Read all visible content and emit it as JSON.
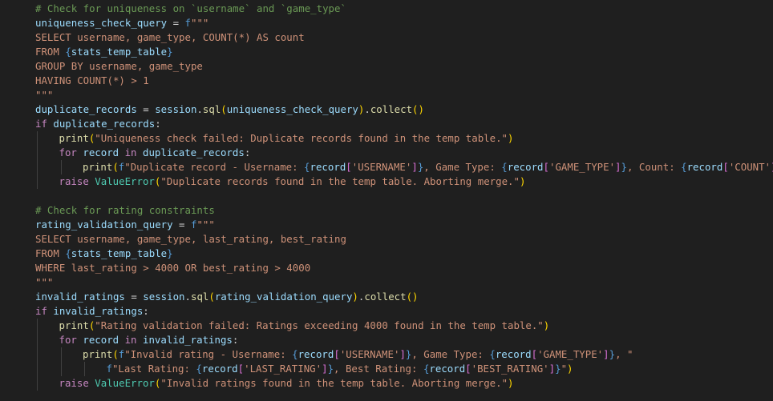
{
  "editor": {
    "language": "python",
    "theme_colors": {
      "background": "#1f1f1f",
      "comment": "#6a9955",
      "variable": "#9cdcfe",
      "string": "#ce9178",
      "keyword": "#c586c0",
      "function": "#dcdcaa",
      "class": "#4ec9b0",
      "brace": "#569cd6",
      "bracket_level_1": "#ffd700",
      "bracket_level_2": "#da70d6",
      "bracket_level_3": "#179fff"
    },
    "lines": [
      {
        "indent": 0,
        "tokens": [
          [
            "comment",
            "# Check for uniqueness on `username` and `game_type`"
          ]
        ]
      },
      {
        "indent": 0,
        "tokens": [
          [
            "var",
            "uniqueness_check_query"
          ],
          [
            "op",
            " = "
          ],
          [
            "brace",
            "f"
          ],
          [
            "str",
            "\"\"\""
          ]
        ]
      },
      {
        "indent": 0,
        "tokens": [
          [
            "str",
            "SELECT username, game_type, COUNT(*) AS count"
          ]
        ]
      },
      {
        "indent": 0,
        "tokens": [
          [
            "str",
            "FROM "
          ],
          [
            "brace",
            "{"
          ],
          [
            "var",
            "stats_temp_table"
          ],
          [
            "brace",
            "}"
          ]
        ]
      },
      {
        "indent": 0,
        "tokens": [
          [
            "str",
            "GROUP BY username, game_type"
          ]
        ]
      },
      {
        "indent": 0,
        "tokens": [
          [
            "str",
            "HAVING COUNT(*) > 1"
          ]
        ]
      },
      {
        "indent": 0,
        "tokens": [
          [
            "str",
            "\"\"\""
          ]
        ]
      },
      {
        "indent": 0,
        "tokens": [
          [
            "var",
            "duplicate_records"
          ],
          [
            "op",
            " = "
          ],
          [
            "var",
            "session"
          ],
          [
            "op",
            "."
          ],
          [
            "fn",
            "sql"
          ],
          [
            "br1",
            "("
          ],
          [
            "var",
            "uniqueness_check_query"
          ],
          [
            "br1",
            ")"
          ],
          [
            "op",
            "."
          ],
          [
            "fn",
            "collect"
          ],
          [
            "br1",
            "()"
          ]
        ]
      },
      {
        "indent": 0,
        "tokens": [
          [
            "kw",
            "if"
          ],
          [
            "op",
            " "
          ],
          [
            "var",
            "duplicate_records"
          ],
          [
            "op",
            ":"
          ]
        ]
      },
      {
        "indent": 1,
        "tokens": [
          [
            "fn",
            "print"
          ],
          [
            "br1",
            "("
          ],
          [
            "str",
            "\"Uniqueness check failed: Duplicate records found in the temp table.\""
          ],
          [
            "br1",
            ")"
          ]
        ]
      },
      {
        "indent": 1,
        "tokens": [
          [
            "kw",
            "for"
          ],
          [
            "op",
            " "
          ],
          [
            "var",
            "record"
          ],
          [
            "op",
            " "
          ],
          [
            "kw",
            "in"
          ],
          [
            "op",
            " "
          ],
          [
            "var",
            "duplicate_records"
          ],
          [
            "op",
            ":"
          ]
        ]
      },
      {
        "indent": 2,
        "tokens": [
          [
            "fn",
            "print"
          ],
          [
            "br1",
            "("
          ],
          [
            "brace",
            "f"
          ],
          [
            "str",
            "\"Duplicate record - Username: "
          ],
          [
            "brace",
            "{"
          ],
          [
            "var",
            "record"
          ],
          [
            "br2",
            "["
          ],
          [
            "str",
            "'USERNAME'"
          ],
          [
            "br2",
            "]"
          ],
          [
            "brace",
            "}"
          ],
          [
            "str",
            ", Game Type: "
          ],
          [
            "brace",
            "{"
          ],
          [
            "var",
            "record"
          ],
          [
            "br2",
            "["
          ],
          [
            "str",
            "'GAME_TYPE'"
          ],
          [
            "br2",
            "]"
          ],
          [
            "brace",
            "}"
          ],
          [
            "str",
            ", Count: "
          ],
          [
            "brace",
            "{"
          ],
          [
            "var",
            "record"
          ],
          [
            "br2",
            "["
          ],
          [
            "str",
            "'COUNT'"
          ],
          [
            "br2",
            "]"
          ],
          [
            "brace",
            "}"
          ],
          [
            "str",
            "\""
          ],
          [
            "br1",
            ")"
          ]
        ]
      },
      {
        "indent": 1,
        "tokens": [
          [
            "kw",
            "raise"
          ],
          [
            "op",
            " "
          ],
          [
            "cls",
            "ValueError"
          ],
          [
            "br1",
            "("
          ],
          [
            "str",
            "\"Duplicate records found in the temp table. Aborting merge.\""
          ],
          [
            "br1",
            ")"
          ]
        ]
      },
      {
        "indent": 0,
        "tokens": []
      },
      {
        "indent": 0,
        "tokens": [
          [
            "comment",
            "# Check for rating constraints"
          ]
        ]
      },
      {
        "indent": 0,
        "tokens": [
          [
            "var",
            "rating_validation_query"
          ],
          [
            "op",
            " = "
          ],
          [
            "brace",
            "f"
          ],
          [
            "str",
            "\"\"\""
          ]
        ]
      },
      {
        "indent": 0,
        "tokens": [
          [
            "str",
            "SELECT username, game_type, last_rating, best_rating"
          ]
        ]
      },
      {
        "indent": 0,
        "tokens": [
          [
            "str",
            "FROM "
          ],
          [
            "brace",
            "{"
          ],
          [
            "var",
            "stats_temp_table"
          ],
          [
            "brace",
            "}"
          ]
        ]
      },
      {
        "indent": 0,
        "tokens": [
          [
            "str",
            "WHERE last_rating > 4000 OR best_rating > 4000"
          ]
        ]
      },
      {
        "indent": 0,
        "tokens": [
          [
            "str",
            "\"\"\""
          ]
        ]
      },
      {
        "indent": 0,
        "tokens": [
          [
            "var",
            "invalid_ratings"
          ],
          [
            "op",
            " = "
          ],
          [
            "var",
            "session"
          ],
          [
            "op",
            "."
          ],
          [
            "fn",
            "sql"
          ],
          [
            "br1",
            "("
          ],
          [
            "var",
            "rating_validation_query"
          ],
          [
            "br1",
            ")"
          ],
          [
            "op",
            "."
          ],
          [
            "fn",
            "collect"
          ],
          [
            "br1",
            "()"
          ]
        ]
      },
      {
        "indent": 0,
        "tokens": [
          [
            "kw",
            "if"
          ],
          [
            "op",
            " "
          ],
          [
            "var",
            "invalid_ratings"
          ],
          [
            "op",
            ":"
          ]
        ]
      },
      {
        "indent": 1,
        "tokens": [
          [
            "fn",
            "print"
          ],
          [
            "br1",
            "("
          ],
          [
            "str",
            "\"Rating validation failed: Ratings exceeding 4000 found in the temp table.\""
          ],
          [
            "br1",
            ")"
          ]
        ]
      },
      {
        "indent": 1,
        "tokens": [
          [
            "kw",
            "for"
          ],
          [
            "op",
            " "
          ],
          [
            "var",
            "record"
          ],
          [
            "op",
            " "
          ],
          [
            "kw",
            "in"
          ],
          [
            "op",
            " "
          ],
          [
            "var",
            "invalid_ratings"
          ],
          [
            "op",
            ":"
          ]
        ]
      },
      {
        "indent": 2,
        "tokens": [
          [
            "fn",
            "print"
          ],
          [
            "br1",
            "("
          ],
          [
            "brace",
            "f"
          ],
          [
            "str",
            "\"Invalid rating - Username: "
          ],
          [
            "brace",
            "{"
          ],
          [
            "var",
            "record"
          ],
          [
            "br2",
            "["
          ],
          [
            "str",
            "'USERNAME'"
          ],
          [
            "br2",
            "]"
          ],
          [
            "brace",
            "}"
          ],
          [
            "str",
            ", Game Type: "
          ],
          [
            "brace",
            "{"
          ],
          [
            "var",
            "record"
          ],
          [
            "br2",
            "["
          ],
          [
            "str",
            "'GAME_TYPE'"
          ],
          [
            "br2",
            "]"
          ],
          [
            "brace",
            "}"
          ],
          [
            "str",
            ", \""
          ]
        ]
      },
      {
        "indent": 3,
        "tokens": [
          [
            "brace",
            "f"
          ],
          [
            "str",
            "\"Last Rating: "
          ],
          [
            "brace",
            "{"
          ],
          [
            "var",
            "record"
          ],
          [
            "br2",
            "["
          ],
          [
            "str",
            "'LAST_RATING'"
          ],
          [
            "br2",
            "]"
          ],
          [
            "brace",
            "}"
          ],
          [
            "str",
            ", Best Rating: "
          ],
          [
            "brace",
            "{"
          ],
          [
            "var",
            "record"
          ],
          [
            "br2",
            "["
          ],
          [
            "str",
            "'BEST_RATING'"
          ],
          [
            "br2",
            "]"
          ],
          [
            "brace",
            "}"
          ],
          [
            "str",
            "\""
          ],
          [
            "br1",
            ")"
          ]
        ]
      },
      {
        "indent": 1,
        "tokens": [
          [
            "kw",
            "raise"
          ],
          [
            "op",
            " "
          ],
          [
            "cls",
            "ValueError"
          ],
          [
            "br1",
            "("
          ],
          [
            "str",
            "\"Invalid ratings found in the temp table. Aborting merge.\""
          ],
          [
            "br1",
            ")"
          ]
        ]
      }
    ]
  }
}
